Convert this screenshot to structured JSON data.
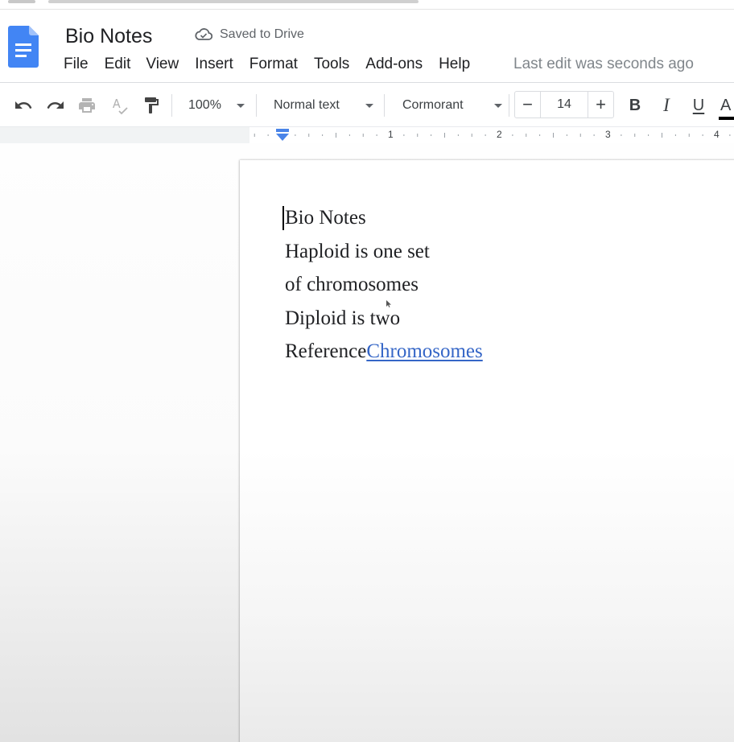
{
  "document": {
    "title": "Bio Notes",
    "save_status": "Saved to Drive",
    "last_edit": "Last edit was seconds ago"
  },
  "menu": [
    "File",
    "Edit",
    "View",
    "Insert",
    "Format",
    "Tools",
    "Add-ons",
    "Help"
  ],
  "toolbar": {
    "zoom": "100%",
    "style": "Normal text",
    "font": "Cormorant",
    "font_size": "14",
    "minus": "−",
    "plus": "+",
    "bold": "B",
    "italic": "I",
    "underline": "U",
    "text_color": "A",
    "icons": [
      "undo-icon",
      "redo-icon",
      "print-icon",
      "spellcheck-icon",
      "paint-format-icon"
    ]
  },
  "ruler": {
    "marks": [
      "1",
      "2",
      "3",
      "4"
    ]
  },
  "content": {
    "lines": [
      "Bio Notes",
      "Haploid is one set",
      "of chromosomes",
      "Diploid is two"
    ],
    "reference_prefix": "Reference",
    "reference_link": "Chromosomes"
  },
  "colors": {
    "brand_blue": "#4285f4",
    "link": "#3566c7",
    "text": "#202124",
    "muted": "#80868b"
  }
}
